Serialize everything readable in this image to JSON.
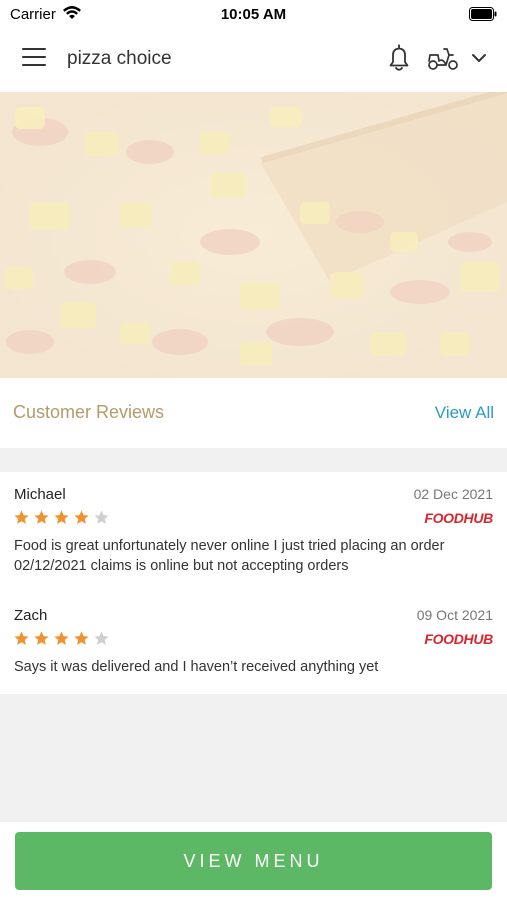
{
  "status_bar": {
    "carrier": "Carrier",
    "time": "10:05 AM"
  },
  "header": {
    "title": "pizza choice",
    "icons": [
      "menu-icon",
      "bell-icon",
      "scooter-icon",
      "chevron-down-icon"
    ]
  },
  "hero": {
    "image": "pineapple-pizza-photo"
  },
  "reviews_section": {
    "title": "Customer Reviews",
    "view_all_label": "View All"
  },
  "reviews": [
    {
      "name": "Michael",
      "date": "02 Dec 2021",
      "rating": 4,
      "max_rating": 5,
      "source": "FOODHUB",
      "text": "Food is great unfortunately never online I just tried placing an order 02/12/2021 claims is online but not accepting orders"
    },
    {
      "name": "Zach",
      "date": "09 Oct 2021",
      "rating": 4,
      "max_rating": 5,
      "source": "FOODHUB",
      "text": "Says it was delivered and I haven’t received anything yet"
    }
  ],
  "footer": {
    "button_label": "VIEW MENU"
  },
  "colors": {
    "accent_green": "#5cb865",
    "link_blue": "#2d9ac8",
    "star_orange": "#f0922e",
    "title_tan": "#b59a6a",
    "foodhub_red": "#d9262c"
  }
}
